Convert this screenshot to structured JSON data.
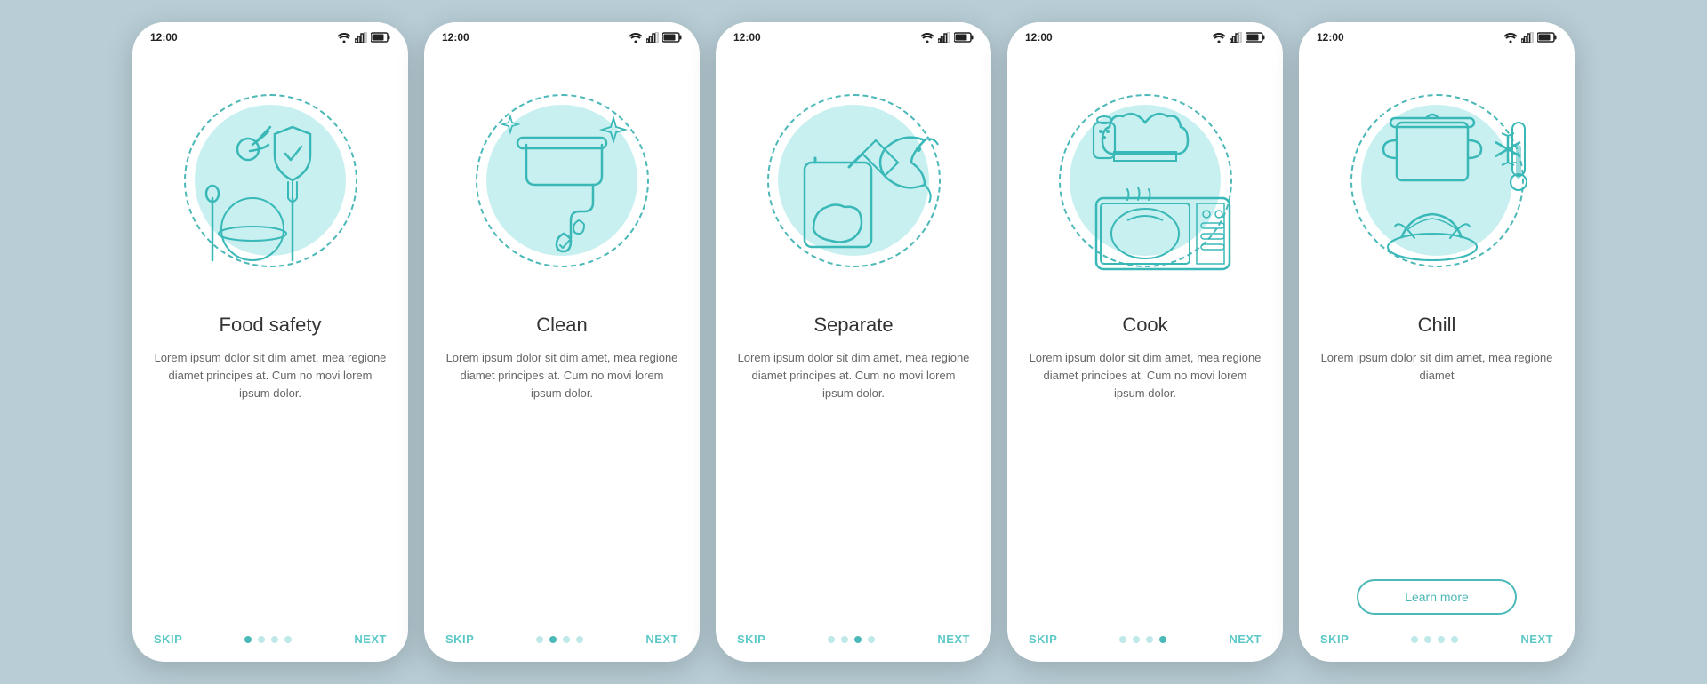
{
  "screens": [
    {
      "id": "food-safety",
      "time": "12:00",
      "title": "Food safety",
      "body": "Lorem ipsum dolor sit dim amet, mea regione diamet principes at. Cum no movi lorem ipsum dolor.",
      "dots": [
        true,
        false,
        false,
        false
      ],
      "skip_label": "SKIP",
      "next_label": "NEXT",
      "illustration": "food-safety",
      "has_learn_more": false,
      "learn_more_label": ""
    },
    {
      "id": "clean",
      "time": "12:00",
      "title": "Clean",
      "body": "Lorem ipsum dolor sit dim amet, mea regione diamet principes at. Cum no movi lorem ipsum dolor.",
      "dots": [
        false,
        true,
        false,
        false
      ],
      "skip_label": "SKIP",
      "next_label": "NEXT",
      "illustration": "clean",
      "has_learn_more": false,
      "learn_more_label": ""
    },
    {
      "id": "separate",
      "time": "12:00",
      "title": "Separate",
      "body": "Lorem ipsum dolor sit dim amet, mea regione diamet principes at. Cum no movi lorem ipsum dolor.",
      "dots": [
        false,
        false,
        true,
        false
      ],
      "skip_label": "SKIP",
      "next_label": "NEXT",
      "illustration": "separate",
      "has_learn_more": false,
      "learn_more_label": ""
    },
    {
      "id": "cook",
      "time": "12:00",
      "title": "Cook",
      "body": "Lorem ipsum dolor sit dim amet, mea regione diamet principes at. Cum no movi lorem ipsum dolor.",
      "dots": [
        false,
        false,
        false,
        true
      ],
      "skip_label": "SKIP",
      "next_label": "NEXT",
      "illustration": "cook",
      "has_learn_more": false,
      "learn_more_label": ""
    },
    {
      "id": "chill",
      "time": "12:00",
      "title": "Chill",
      "body": "Lorem ipsum dolor sit dim amet, mea regione diamet",
      "dots": [
        false,
        false,
        false,
        false
      ],
      "skip_label": "SKIP",
      "next_label": "NEXT",
      "illustration": "chill",
      "has_learn_more": true,
      "learn_more_label": "Learn more"
    }
  ]
}
